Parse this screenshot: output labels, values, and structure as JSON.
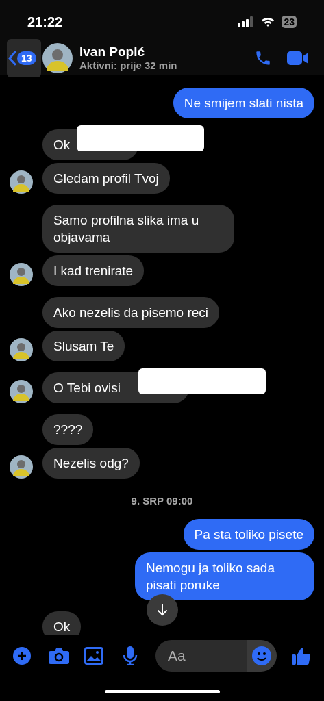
{
  "status_bar": {
    "time": "21:22",
    "battery": "23"
  },
  "header": {
    "back_badge": "13",
    "name": "Ivan Popić",
    "status": "Aktivni: prije 32 min"
  },
  "messages": [
    {
      "kind": "outgoing",
      "text": "Ne smijem slati nista"
    },
    {
      "kind": "incoming",
      "text": "Ok",
      "avatar": false,
      "redacted": true
    },
    {
      "kind": "incoming",
      "text": "Gledam profil Tvoj",
      "avatar": true,
      "redacted": false
    },
    {
      "kind": "incoming",
      "text": "Samo profilna slika ima u objavama",
      "avatar": false,
      "redacted": false
    },
    {
      "kind": "incoming",
      "text": "I kad trenirate",
      "avatar": true,
      "redacted": false
    },
    {
      "kind": "incoming",
      "text": "Ako nezelis da pisemo reci",
      "avatar": false,
      "redacted": false
    },
    {
      "kind": "incoming",
      "text": "Slusam Te",
      "avatar": true,
      "redacted": false
    },
    {
      "kind": "incoming",
      "text": "O Tebi ovisi",
      "avatar": true,
      "redacted": true
    },
    {
      "kind": "incoming",
      "text": "????",
      "avatar": false,
      "redacted": false
    },
    {
      "kind": "incoming",
      "text": "Nezelis odg?",
      "avatar": true,
      "redacted": false
    },
    {
      "kind": "date",
      "text": "9. SRP 09:00"
    },
    {
      "kind": "outgoing",
      "text": "Pa sta toliko pisete"
    },
    {
      "kind": "outgoing",
      "text": "Nemogu ja toliko sada pisati poruke"
    },
    {
      "kind": "incoming",
      "text": "Ok",
      "avatar": false,
      "redacted": false
    }
  ],
  "composer": {
    "placeholder": "Aa"
  }
}
